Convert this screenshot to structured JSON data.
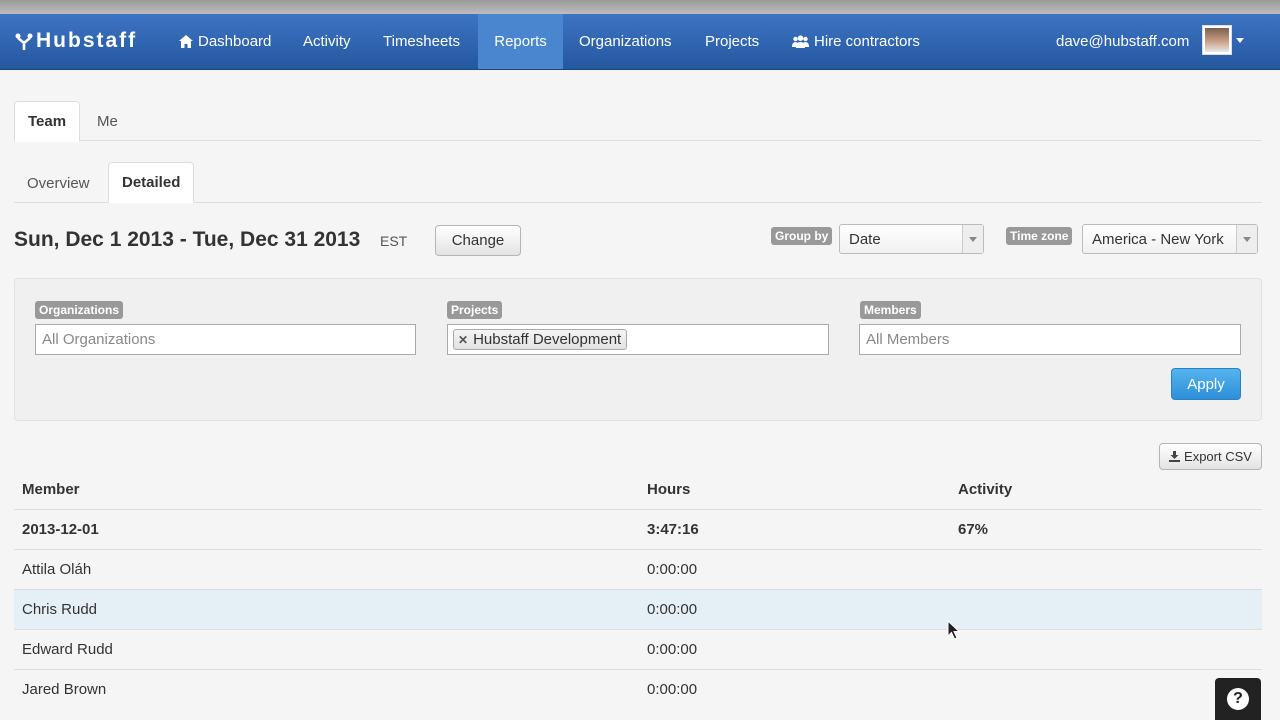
{
  "navbar": {
    "brand": "Hubstaff",
    "items": [
      {
        "label": "Dashboard",
        "icon": "home-icon"
      },
      {
        "label": "Activity"
      },
      {
        "label": "Timesheets"
      },
      {
        "label": "Reports",
        "active": true
      },
      {
        "label": "Organizations"
      },
      {
        "label": "Projects"
      },
      {
        "label": "Hire contractors",
        "icon": "users-icon"
      }
    ],
    "user_email": "dave@hubstaff.com"
  },
  "scope_tabs": [
    {
      "label": "Team",
      "active": true
    },
    {
      "label": "Me"
    }
  ],
  "view_tabs": [
    {
      "label": "Overview"
    },
    {
      "label": "Detailed",
      "active": true
    }
  ],
  "date_range": {
    "title": "Sun, Dec 1 2013 - Tue, Dec 31 2013",
    "timezone_abbr": "EST",
    "change_label": "Change"
  },
  "group_by": {
    "label": "Group by",
    "value": "Date"
  },
  "time_zone": {
    "label": "Time zone",
    "value": "America - New York"
  },
  "filters": {
    "organizations": {
      "label": "Organizations",
      "placeholder": "All Organizations"
    },
    "projects": {
      "label": "Projects",
      "tokens": [
        "Hubstaff Development"
      ]
    },
    "members": {
      "label": "Members",
      "placeholder": "All Members"
    },
    "apply_label": "Apply"
  },
  "export_label": "Export CSV",
  "table": {
    "columns": [
      "Member",
      "Hours",
      "Activity"
    ],
    "rows": [
      {
        "member": "2013-12-01",
        "hours": "3:47:16",
        "activity": "67%",
        "group": true
      },
      {
        "member": "Attila Oláh",
        "hours": "0:00:00",
        "activity": ""
      },
      {
        "member": "Chris Rudd",
        "hours": "0:00:00",
        "activity": "",
        "highlight": true
      },
      {
        "member": "Edward Rudd",
        "hours": "0:00:00",
        "activity": ""
      },
      {
        "member": "Jared Brown",
        "hours": "0:00:00",
        "activity": ""
      }
    ]
  },
  "help_label": "?",
  "colors": {
    "navbar": "#2f66b3",
    "nav_active": "#4a86d0",
    "apply": "#3a9be0",
    "row_highlight": "#e4f0f6"
  }
}
